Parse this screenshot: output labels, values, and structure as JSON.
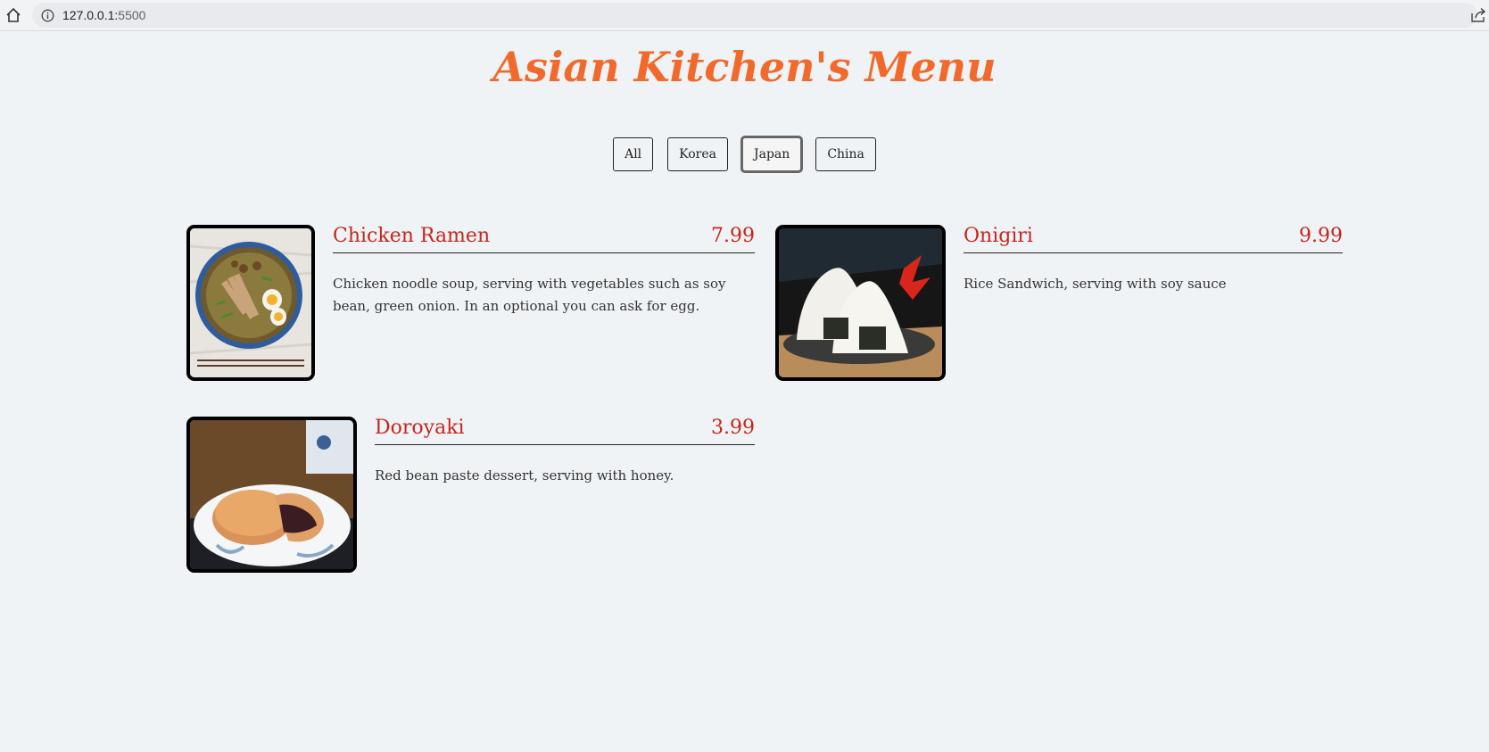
{
  "browser": {
    "url_host": "127.0.0.1:",
    "url_port": "5500"
  },
  "page": {
    "title": "Asian Kitchen's Menu"
  },
  "filters": [
    {
      "label": "All"
    },
    {
      "label": "Korea"
    },
    {
      "label": "Japan",
      "active": true
    },
    {
      "label": "China"
    }
  ],
  "menu": [
    {
      "name": "Chicken Ramen",
      "price": "7.99",
      "description": "Chicken noodle soup, serving with vegetables such as soy bean, green onion. In an optional you can ask for egg."
    },
    {
      "name": "Onigiri",
      "price": "9.99",
      "description": "Rice Sandwich, serving with soy sauce"
    },
    {
      "name": "Doroyaki",
      "price": "3.99",
      "description": "Red bean paste dessert, serving with honey."
    }
  ],
  "colors": {
    "title": "#f26a2b",
    "item_name": "#c7261c",
    "background": "#f0f3f6"
  }
}
